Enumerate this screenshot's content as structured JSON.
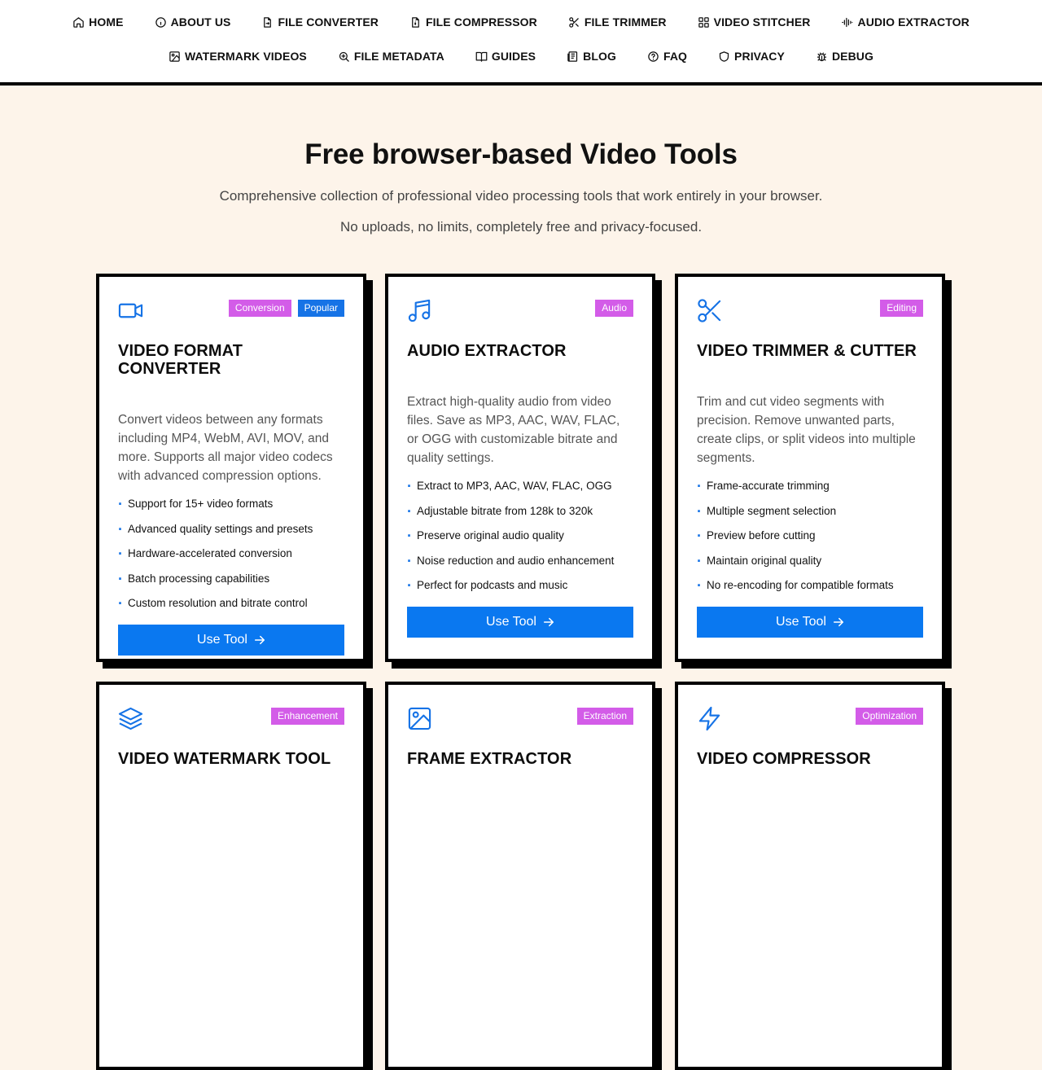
{
  "nav": {
    "row1": [
      {
        "label": "HOME",
        "icon": "home-icon"
      },
      {
        "label": "ABOUT US",
        "icon": "info-icon"
      },
      {
        "label": "FILE CONVERTER",
        "icon": "file-convert-icon"
      },
      {
        "label": "FILE COMPRESSOR",
        "icon": "file-zip-icon"
      },
      {
        "label": "FILE TRIMMER",
        "icon": "scissors-icon"
      },
      {
        "label": "VIDEO STITCHER",
        "icon": "grid-icon"
      },
      {
        "label": "AUDIO EXTRACTOR",
        "icon": "waveform-icon"
      }
    ],
    "row2": [
      {
        "label": "WATERMARK VIDEOS",
        "icon": "image-edit-icon"
      },
      {
        "label": "FILE METADATA",
        "icon": "search-zoom-icon"
      },
      {
        "label": "GUIDES",
        "icon": "book-icon"
      },
      {
        "label": "BLOG",
        "icon": "newspaper-icon"
      },
      {
        "label": "FAQ",
        "icon": "question-icon"
      },
      {
        "label": "PRIVACY",
        "icon": "shield-icon"
      },
      {
        "label": "DEBUG",
        "icon": "bug-icon"
      }
    ]
  },
  "hero": {
    "title": "Free browser-based Video Tools",
    "line1": "Comprehensive collection of professional video processing tools that work entirely in your browser.",
    "line2": "No uploads, no limits, completely free and privacy-focused."
  },
  "colors": {
    "accent": "#0a78f0",
    "tag_pink": "#d35ce8",
    "bg": "#fdf4ea"
  },
  "cards": [
    {
      "icon": "video-camera-icon",
      "tags": [
        "Conversion",
        "Popular"
      ],
      "title": "VIDEO FORMAT CONVERTER",
      "description": "Convert videos between any formats including MP4, WebM, AVI, MOV, and more. Supports all major video codecs with advanced compression options.",
      "features": [
        "Support for 15+ video formats",
        "Advanced quality settings and presets",
        "Hardware-accelerated conversion",
        "Batch processing capabilities",
        "Custom resolution and bitrate control"
      ],
      "button": "Use Tool"
    },
    {
      "icon": "music-note-icon",
      "tags": [
        "Audio"
      ],
      "title": "AUDIO EXTRACTOR",
      "description": "Extract high-quality audio from video files. Save as MP3, AAC, WAV, FLAC, or OGG with customizable bitrate and quality settings.",
      "features": [
        "Extract to MP3, AAC, WAV, FLAC, OGG",
        "Adjustable bitrate from 128k to 320k",
        "Preserve original audio quality",
        "Noise reduction and audio enhancement",
        "Perfect for podcasts and music"
      ],
      "button": "Use Tool"
    },
    {
      "icon": "scissors-icon",
      "tags": [
        "Editing"
      ],
      "title": "VIDEO TRIMMER & CUTTER",
      "description": "Trim and cut video segments with precision. Remove unwanted parts, create clips, or split videos into multiple segments.",
      "features": [
        "Frame-accurate trimming",
        "Multiple segment selection",
        "Preview before cutting",
        "Maintain original quality",
        "No re-encoding for compatible formats"
      ],
      "button": "Use Tool"
    },
    {
      "icon": "layers-icon",
      "tags": [
        "Enhancement"
      ],
      "title": "VIDEO WATERMARK TOOL"
    },
    {
      "icon": "image-icon",
      "tags": [
        "Extraction"
      ],
      "title": "FRAME EXTRACTOR"
    },
    {
      "icon": "lightning-icon",
      "tags": [
        "Optimization"
      ],
      "title": "VIDEO COMPRESSOR"
    }
  ]
}
